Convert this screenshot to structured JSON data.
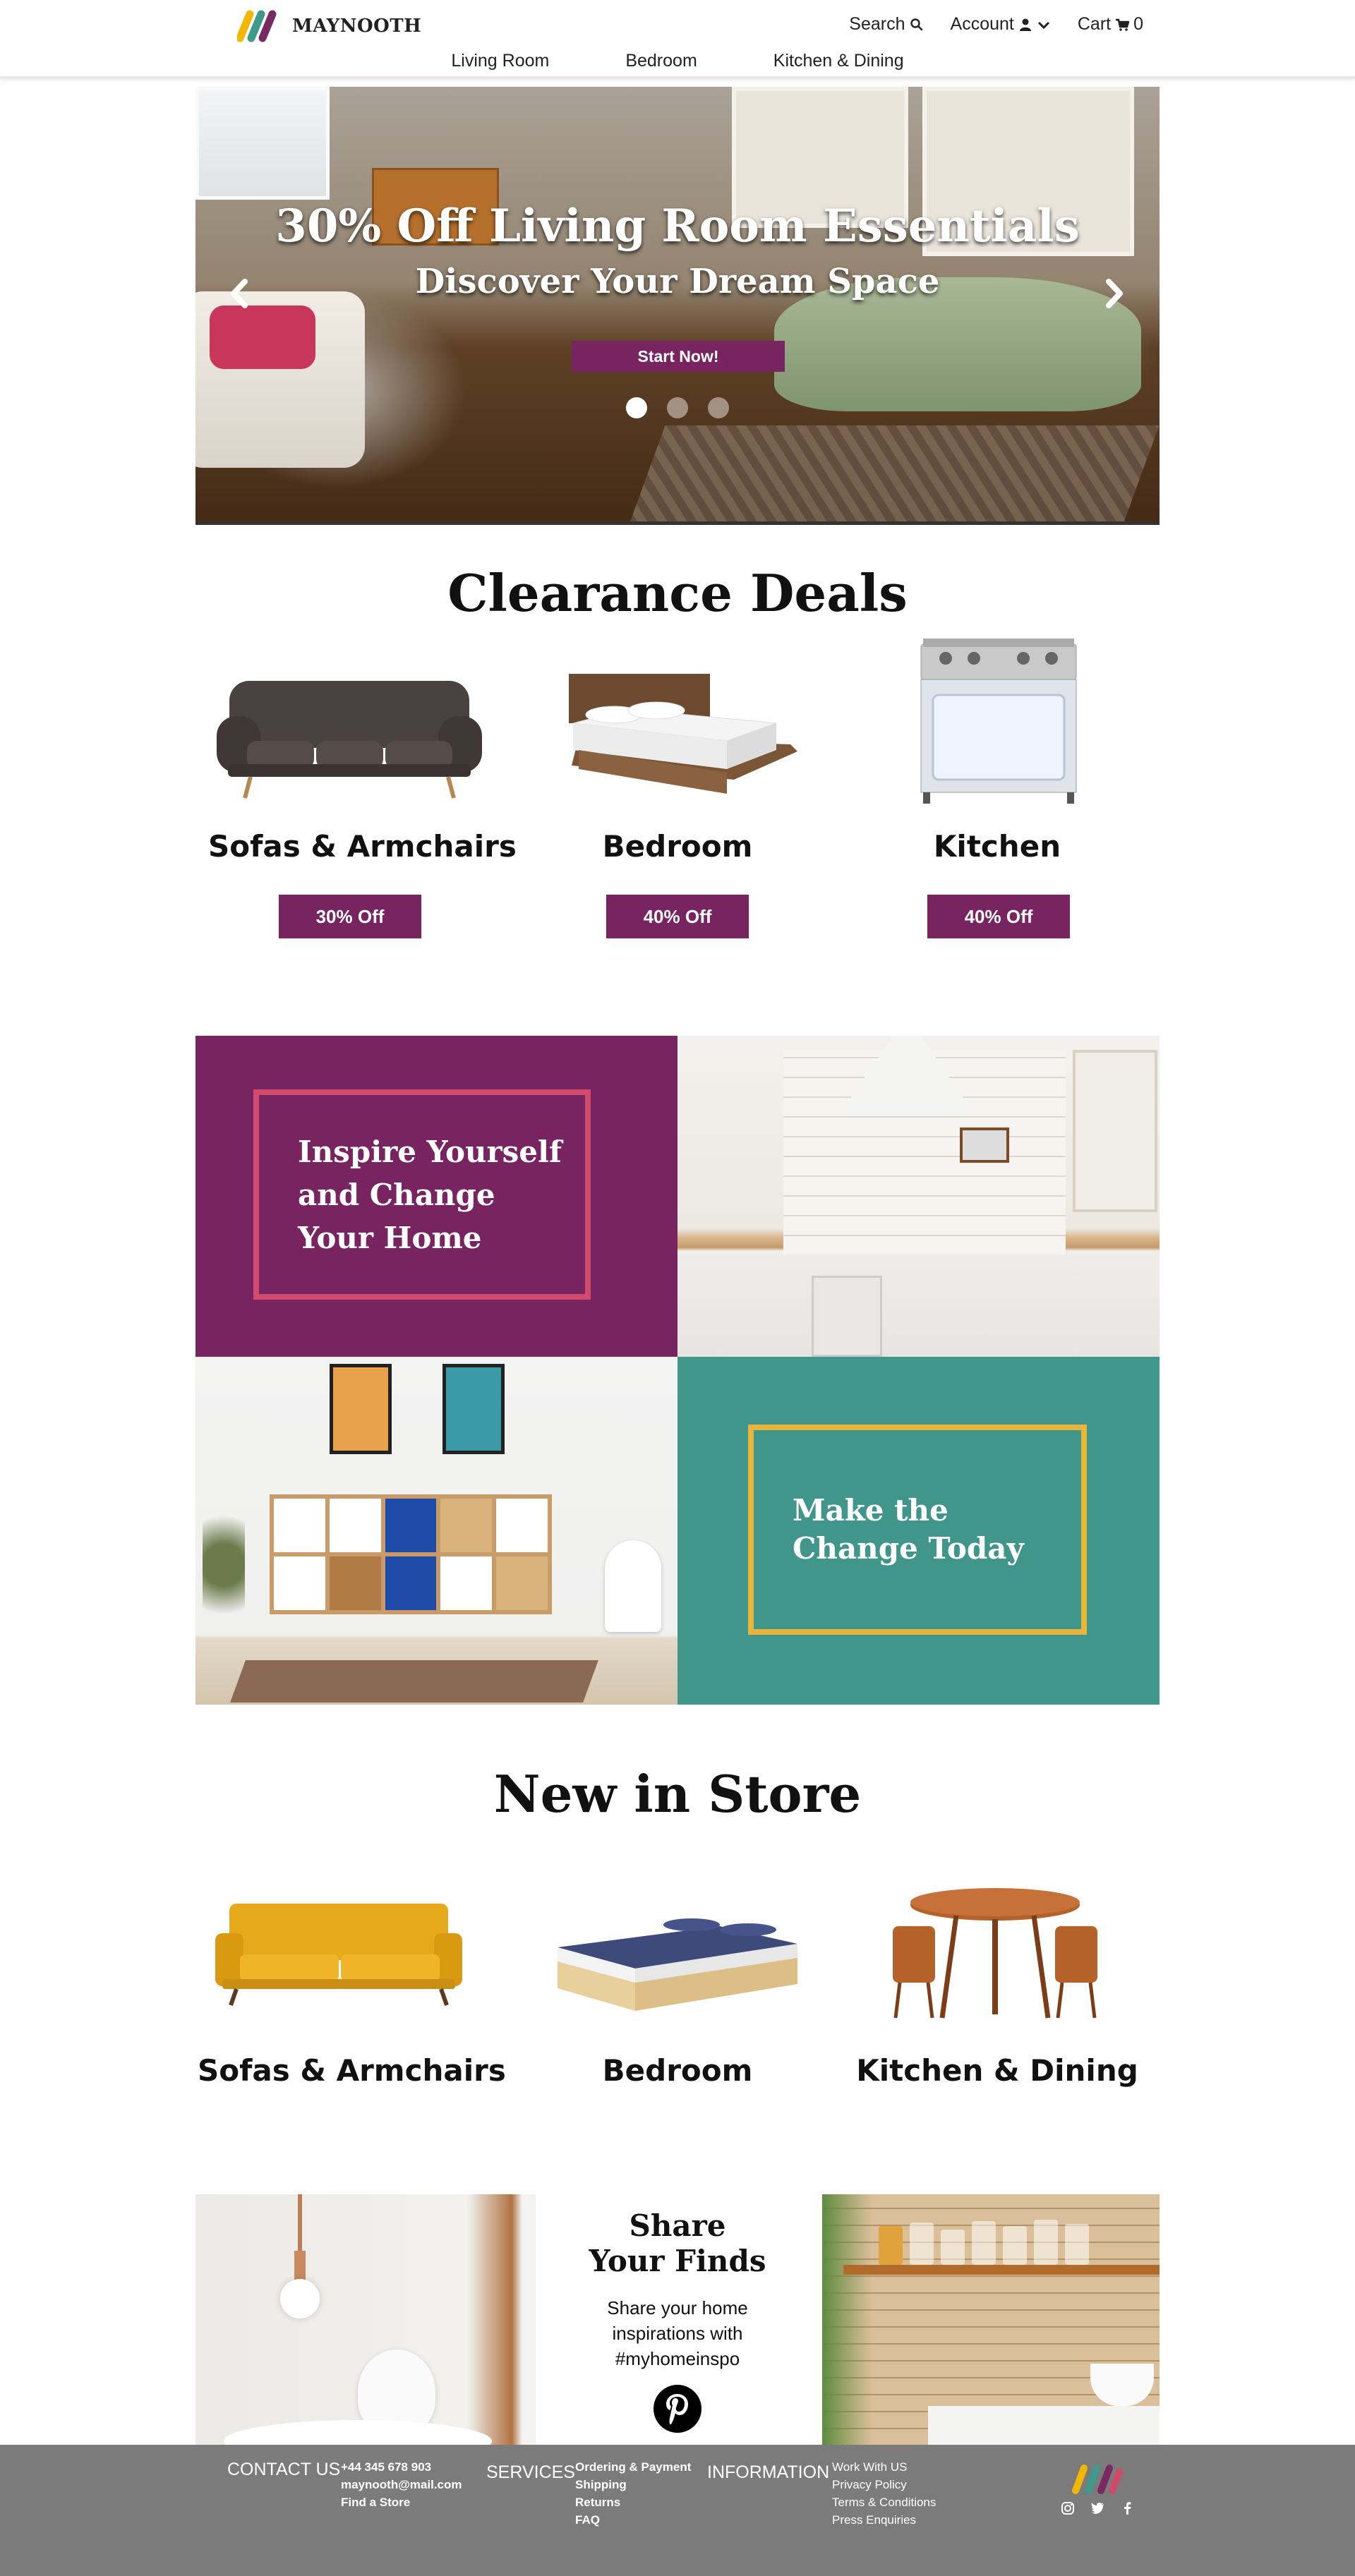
{
  "brand": {
    "name": "MAYNOOTH",
    "colors": [
      "#f2b705",
      "#3f9a8c",
      "#7a2a63",
      "#d04a6a"
    ]
  },
  "header": {
    "utility": [
      {
        "label": "Search",
        "icon": "search-icon"
      },
      {
        "label": "Account",
        "icon": "user-icon"
      },
      {
        "label": "Cart",
        "icon": "cart-icon",
        "count": "0"
      }
    ],
    "nav": [
      "Living Room",
      "Bedroom",
      "Kitchen & Dining"
    ]
  },
  "hero": {
    "title": "30% Off Living Room Essentials",
    "subtitle": "Discover Your Dream Space",
    "cta": "Start Now!",
    "slides": 3,
    "active_slide": 1
  },
  "clearance": {
    "title": "Clearance Deals",
    "items": [
      {
        "name": "Sofas & Armchairs",
        "discount": "30% Off"
      },
      {
        "name": "Bedroom",
        "discount": "40% Off"
      },
      {
        "name": "Kitchen",
        "discount": "40% Off"
      }
    ]
  },
  "inspire": {
    "tile1": "Inspire Yourself and Change Your Home",
    "tile2": "Make the Change Today",
    "colors": {
      "plum": "#782460",
      "teal": "#41968b",
      "pink_frame": "#d24a6e",
      "gold_frame": "#e9b43a"
    }
  },
  "new_in_store": {
    "title": "New in Store",
    "items": [
      "Sofas & Armchairs",
      "Bedroom",
      "Kitchen & Dining"
    ]
  },
  "share": {
    "title_line1": "Share",
    "title_line2": "Your Finds",
    "text_line1": "Share your home",
    "text_line2": "inspirations with",
    "text_line3": "#myhomeinspo"
  },
  "footer": {
    "contact_head": "CONTACT US",
    "contact": [
      "+44 345 678 903",
      "maynooth@mail.com",
      "Find a Store"
    ],
    "services_head": "SERVICES",
    "services": [
      "Ordering & Payment",
      "Shipping",
      "Returns",
      "FAQ"
    ],
    "info_head": "INFORMATION",
    "info": [
      "Work With US",
      "Privacy Policy",
      "Terms & Conditions",
      "Press Enquiries"
    ]
  }
}
